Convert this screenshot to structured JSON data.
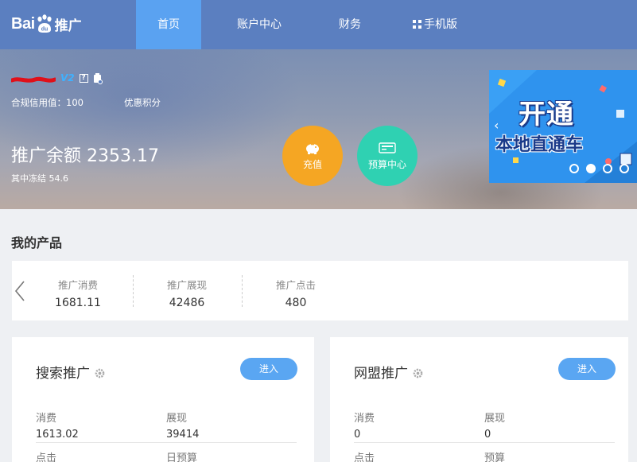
{
  "logo": {
    "brand_prefix": "Bai",
    "brand_suffix": "推广"
  },
  "nav": {
    "items": [
      {
        "label": "首页",
        "active": true
      },
      {
        "label": "账户中心",
        "active": false
      },
      {
        "label": "财务",
        "active": false
      },
      {
        "label": "手机版",
        "active": false,
        "icon": "qr-grid-icon"
      }
    ]
  },
  "account": {
    "vip_level": "V2",
    "help_mark": "?",
    "credit": "合规信用值：100",
    "points_link": "优惠积分",
    "balance": "推广余额 2353.17",
    "frozen": "其中冻结 54.6"
  },
  "actions": {
    "recharge_label": "充值",
    "budget_label": "预算中心"
  },
  "banner": {
    "line1": "开通",
    "line2": "本地直通车",
    "dot_count": 4,
    "active_dot": 1
  },
  "products": {
    "section_title": "我的产品",
    "stats": [
      {
        "label": "推广消费",
        "value": "1681.11"
      },
      {
        "label": "推广展现",
        "value": "42486"
      },
      {
        "label": "推广点击",
        "value": "480"
      }
    ]
  },
  "cards": [
    {
      "title": "搜索推广",
      "enter_label": "进入",
      "metrics": [
        {
          "label": "消费",
          "value": "1613.02"
        },
        {
          "label": "展现",
          "value": "39414"
        }
      ],
      "next_labels": [
        "点击",
        "日预算"
      ]
    },
    {
      "title": "网盟推广",
      "enter_label": "进入",
      "metrics": [
        {
          "label": "消费",
          "value": "0"
        },
        {
          "label": "展现",
          "value": "0"
        }
      ],
      "next_labels": [
        "点击",
        "预算"
      ]
    }
  ],
  "colors": {
    "nav_bg": "#5b7fc0",
    "nav_active": "#5aa2f1",
    "recharge": "#f5a623",
    "budget": "#2fd1b2",
    "enter_button": "#5aa6f2"
  }
}
